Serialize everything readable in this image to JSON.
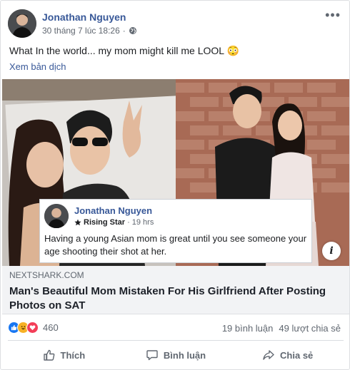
{
  "post": {
    "author": "Jonathan Nguyen",
    "timestamp": "30 tháng 7 lúc 18:26",
    "audience_icon": "globe-icon",
    "more_icon": "more-options-icon",
    "text": "What In the world... my mom might kill me LOOL 😳",
    "translate_label": "Xem bản dịch"
  },
  "link_preview": {
    "quote": {
      "author": "Jonathan Nguyen",
      "badge": "Rising Star",
      "time": "19 hrs",
      "text": "Having a young Asian mom is great until you see someone your age shooting their shot at her."
    },
    "info_label": "i",
    "domain": "NEXTSHARK.COM",
    "title": "Man's Beautiful Mom Mistaken For His Girlfriend After Posting Photos on SAT"
  },
  "stats": {
    "reaction_count": "460",
    "comments": "19 bình luận",
    "shares": "49 lượt chia sẻ"
  },
  "actions": {
    "like": "Thích",
    "comment": "Bình luận",
    "share": "Chia sẻ"
  },
  "colors": {
    "link_blue": "#385898",
    "like_blue": "#1877f2",
    "secondary_text": "#606770"
  }
}
